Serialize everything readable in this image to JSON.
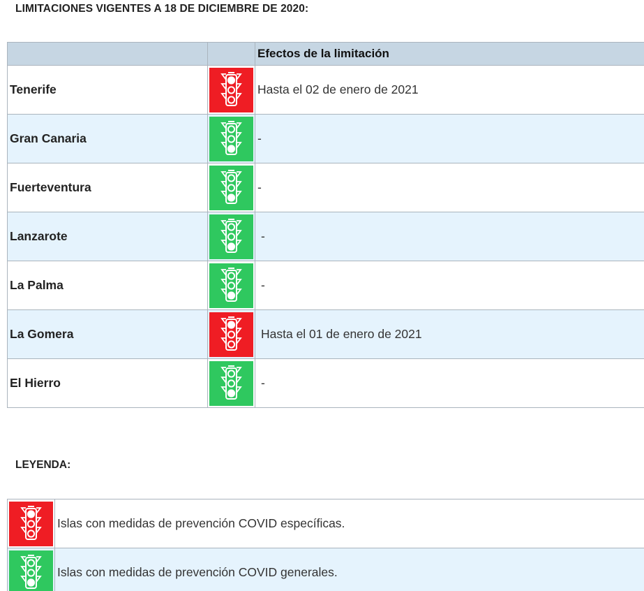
{
  "heading": "LIMITACIONES VIGENTES A 18 DE DICIEMBRE DE 2020:",
  "table": {
    "headers": [
      "",
      "",
      "Efectos de la limitación"
    ],
    "rows": [
      {
        "island": "Tenerife",
        "status": "red",
        "effect": "Hasta el 02 de enero de 2021"
      },
      {
        "island": "Gran Canaria",
        "status": "green",
        "effect": "-"
      },
      {
        "island": "Fuerteventura",
        "status": "green",
        "effect": "-"
      },
      {
        "island": "Lanzarote",
        "status": "green",
        "effect": "-"
      },
      {
        "island": "La Palma",
        "status": "green",
        "effect": "-"
      },
      {
        "island": "La Gomera",
        "status": "red",
        "effect": "Hasta el 01 de enero de 2021"
      },
      {
        "island": "El Hierro",
        "status": "green",
        "effect": "-"
      }
    ]
  },
  "legend": {
    "heading": "LEYENDA:",
    "items": [
      {
        "status": "red",
        "text": "Islas con medidas de prevención COVID específicas."
      },
      {
        "status": "green",
        "text": "Islas con medidas de prevención COVID generales."
      }
    ]
  },
  "colors": {
    "red": "#ef1d24",
    "green": "#2fc85f",
    "header_bg": "#c6d6e3",
    "alt_row_bg": "#e5f3fd"
  },
  "icons": {
    "traffic_light": "traffic-light-icon"
  }
}
